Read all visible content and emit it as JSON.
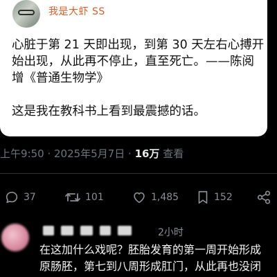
{
  "quoted_post": {
    "username": "我是大虾 SS",
    "text_lines": [
      "心脏于第 21 天即出现，到第 30 天左右心搏开",
      "始出现，从此再不停止，直至死亡。——陈阅",
      "增《普通生物学》",
      "",
      "这是我在教科书上看到最震撼的话。"
    ]
  },
  "meta": {
    "timestamp": "上午9:50 · 2025年5月7日 · ",
    "views_count": "16万",
    "views_label": " 查看"
  },
  "actions": {
    "replies": "37",
    "reposts": "101",
    "likes": "1,485",
    "bookmarks": "152",
    "icons": [
      "reply-icon",
      "repost-icon",
      "like-icon",
      "bookmark-icon",
      "share-icon"
    ]
  },
  "reply": {
    "time": "2小时",
    "text_lines": [
      "在这加什么戏呢？胚胎发育的第一周开始形成",
      "原肠胚，第七到八周形成肛门，从此再也没闭"
    ]
  },
  "colors": {
    "background": "#000000",
    "card": "#ffffff",
    "username": "#d4612a",
    "muted": "#6e767d",
    "text": "#f2f2f2"
  }
}
